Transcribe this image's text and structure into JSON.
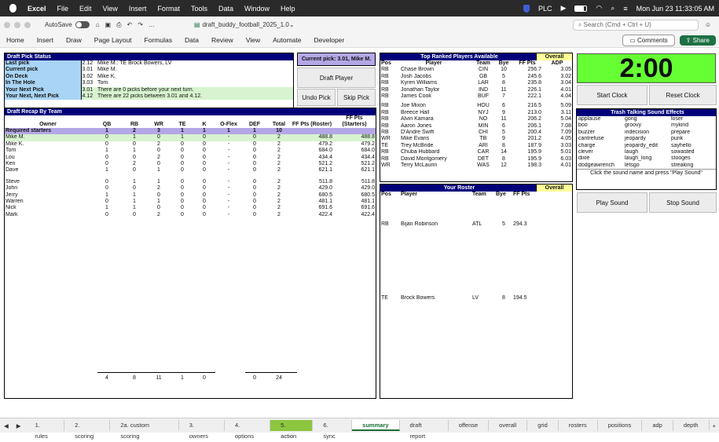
{
  "menubar": {
    "app": "Excel",
    "items": [
      "File",
      "Edit",
      "View",
      "Insert",
      "Format",
      "Tools",
      "Data",
      "Window",
      "Help"
    ],
    "plc": "PLC",
    "datetime": "Mon Jun 23  11:33:05 AM"
  },
  "titlebar": {
    "autosave": "AutoSave",
    "filename": "draft_buddy_football_2025_1.0",
    "search_placeholder": "Search (Cmd + Ctrl + U)"
  },
  "ribbon": {
    "tabs": [
      "Home",
      "Insert",
      "Draw",
      "Page Layout",
      "Formulas",
      "Data",
      "Review",
      "View",
      "Automate",
      "Developer"
    ],
    "comments": "Comments",
    "share": "Share"
  },
  "status": {
    "title": "Draft Pick Status",
    "rows": [
      {
        "label": "Last pick",
        "num": "2.12",
        "text": "Mike M.: TE Brock Bowers, LV"
      },
      {
        "label": "Current pick",
        "num": "3.01",
        "text": "Mike M."
      },
      {
        "label": "On Deck",
        "num": "3.02",
        "text": "Mike K."
      },
      {
        "label": "In The Hole",
        "num": "3.03",
        "text": "Tom"
      },
      {
        "label": "Your Next Pick",
        "num": "3.01",
        "text": "There are 0 picks before your next turn."
      },
      {
        "label": "Your Next, Next Pick",
        "num": "4.12",
        "text": "There are 22 picks between 3.01 and 4.12."
      }
    ]
  },
  "current_pick": "Current pick: 3.01, Mike M.",
  "buttons": {
    "draft_player": "Draft Player",
    "undo_pick": "Undo Pick",
    "skip_pick": "Skip Pick",
    "start_clock": "Start Clock",
    "reset_clock": "Reset Clock",
    "play_sound": "Play Sound",
    "stop_sound": "Stop Sound"
  },
  "clock": "2:00",
  "recap": {
    "title": "Draft Recap By Team",
    "headers": [
      "Owner",
      "QB",
      "RB",
      "WR",
      "TE",
      "K",
      "O-Flex",
      "DEF",
      "Total",
      "FF Pts (Roster)",
      "FF Pts (Starters)"
    ],
    "required": [
      "Required starters",
      "1",
      "2",
      "3",
      "1",
      "1",
      "1",
      "1",
      "10"
    ],
    "group1": [
      [
        "Mike M.",
        "0",
        "1",
        "0",
        "1",
        "0",
        "-",
        "0",
        "2",
        "488.8",
        "488.8"
      ],
      [
        "Mike K.",
        "0",
        "0",
        "2",
        "0",
        "0",
        "-",
        "0",
        "2",
        "479.2",
        "479.2"
      ],
      [
        "Tom",
        "1",
        "1",
        "0",
        "0",
        "0",
        "-",
        "0",
        "2",
        "684.0",
        "684.0"
      ],
      [
        "Lou",
        "0",
        "0",
        "2",
        "0",
        "0",
        "-",
        "0",
        "2",
        "434.4",
        "434.4"
      ],
      [
        "Ken",
        "0",
        "2",
        "0",
        "0",
        "0",
        "-",
        "0",
        "2",
        "521.2",
        "521.2"
      ],
      [
        "Dave",
        "1",
        "0",
        "1",
        "0",
        "0",
        "-",
        "0",
        "2",
        "621.1",
        "621.1"
      ]
    ],
    "group2": [
      [
        "Steve",
        "0",
        "1",
        "1",
        "0",
        "0",
        "-",
        "0",
        "2",
        "511.8",
        "511.8"
      ],
      [
        "John",
        "0",
        "0",
        "2",
        "0",
        "0",
        "-",
        "0",
        "2",
        "429.0",
        "429.0"
      ],
      [
        "Jerry",
        "1",
        "1",
        "0",
        "0",
        "0",
        "-",
        "0",
        "2",
        "680.5",
        "680.5"
      ],
      [
        "Warren",
        "0",
        "1",
        "1",
        "0",
        "0",
        "-",
        "0",
        "2",
        "481.1",
        "481.1"
      ],
      [
        "Nick",
        "1",
        "1",
        "0",
        "0",
        "0",
        "-",
        "0",
        "2",
        "691.6",
        "691.6"
      ],
      [
        "Mark",
        "0",
        "0",
        "2",
        "0",
        "0",
        "-",
        "0",
        "2",
        "422.4",
        "422.4"
      ]
    ],
    "totals": [
      "4",
      "8",
      "11",
      "1",
      "0",
      "",
      "0",
      "24"
    ]
  },
  "available": {
    "title": "Top Ranked Players Available",
    "tag": "Overall",
    "headers": [
      "Pos",
      "Player",
      "Team",
      "Bye",
      "FF Pts",
      "ADP"
    ],
    "rows": [
      [
        "RB",
        "Chase Brown",
        "CIN",
        "10",
        "256.7",
        "3.05"
      ],
      [
        "RB",
        "Josh Jacobs",
        "GB",
        "5",
        "245.6",
        "3.02"
      ],
      [
        "RB",
        "Kyren Williams",
        "LAR",
        "8",
        "235.8",
        "3.04"
      ],
      [
        "RB",
        "Jonathan Taylor",
        "IND",
        "11",
        "226.1",
        "4.01"
      ],
      [
        "RB",
        "James Cook",
        "BUF",
        "7",
        "222.1",
        "4.04"
      ],
      [
        "RB",
        "Joe Mixon",
        "HOU",
        "6",
        "216.5",
        "5.09"
      ],
      [
        "RB",
        "Breece Hall",
        "NYJ",
        "9",
        "213.0",
        "3.11"
      ],
      [
        "RB",
        "Alvin Kamara",
        "NO",
        "11",
        "206.2",
        "5.04"
      ],
      [
        "RB",
        "Aaron Jones",
        "MIN",
        "6",
        "206.1",
        "7.08"
      ],
      [
        "RB",
        "D'Andre Swift",
        "CHI",
        "5",
        "200.4",
        "7.09"
      ],
      [
        "WR",
        "Mike Evans",
        "TB",
        "9",
        "201.2",
        "4.05"
      ],
      [
        "TE",
        "Trey McBride",
        "ARI",
        "8",
        "187.9",
        "3.03"
      ],
      [
        "RB",
        "Chuba Hubbard",
        "CAR",
        "14",
        "195.9",
        "5.01"
      ],
      [
        "RB",
        "David Montgomery",
        "DET",
        "8",
        "195.9",
        "6.03"
      ],
      [
        "WR",
        "Terry McLaurin",
        "WAS",
        "12",
        "198.3",
        "4.01"
      ]
    ]
  },
  "roster": {
    "title": "Your Roster",
    "tag": "Overall",
    "headers": [
      "Pos",
      "Player",
      "Team",
      "Bye",
      "FF Pts"
    ],
    "rows": [
      [
        "RB",
        "Bijan Robinson",
        "ATL",
        "5",
        "294.3"
      ],
      [
        "TE",
        "Brock Bowers",
        "LV",
        "8",
        "194.5"
      ]
    ]
  },
  "sounds": {
    "title": "Trash Talking Sound Effects",
    "cols": [
      [
        "applause",
        "boo",
        "buzzer",
        "cantrefuse",
        "charge",
        "clever",
        "dixie",
        "dodgeawrench"
      ],
      [
        "gong",
        "groovy",
        "indecision",
        "jeopardy",
        "jeopardy_edit",
        "laugh",
        "laugh_long",
        "letsgo"
      ],
      [
        "loser",
        "mykind",
        "prepare",
        "punk",
        "sayhello",
        "sowasted",
        "stooges",
        "streaking"
      ]
    ],
    "hint": "Click the sound name and press \"Play Sound\""
  },
  "sheet_tabs": [
    "1. rules",
    "2. scoring",
    "2a. custom scoring",
    "3. owners",
    "4. options",
    "5. action",
    "6. sync",
    "summary",
    "draft report",
    "offense",
    "overall",
    "grid",
    "rosters",
    "positions",
    "adp",
    "depth"
  ],
  "active_tab": "summary",
  "colors": {
    "header": "#00007a",
    "clock": "#66ff33",
    "green_tab": "#8dc63f"
  }
}
